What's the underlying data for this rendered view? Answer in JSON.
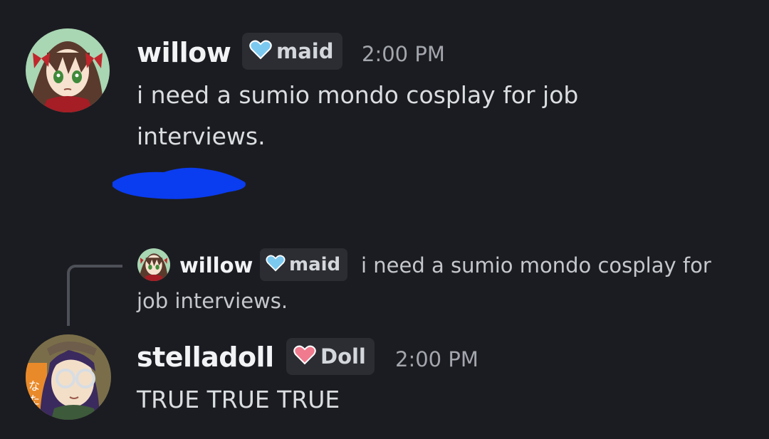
{
  "messages": [
    {
      "username": "willow",
      "role_tag": "maid",
      "role_icon": "blue-heart-icon",
      "timestamp": "2:00 PM",
      "lines": [
        "i need a sumio mondo cosplay for job",
        "interviews."
      ]
    },
    {
      "username": "stelladoll",
      "role_tag": "Doll",
      "role_icon": "pink-heart-icon",
      "timestamp": "2:00 PM",
      "text": "TRUE TRUE TRUE"
    }
  ],
  "reply": {
    "username": "willow",
    "role_tag": "maid",
    "role_icon": "blue-heart-icon",
    "line1": "i need a sumio mondo cosplay for",
    "line2": "job interviews."
  },
  "colors": {
    "background": "#1b1c21",
    "tag_background": "#2b2d33",
    "maid_heart": "#7cc9f0",
    "doll_heart": "#f07a8e",
    "scribble": "#0a3cf0"
  }
}
